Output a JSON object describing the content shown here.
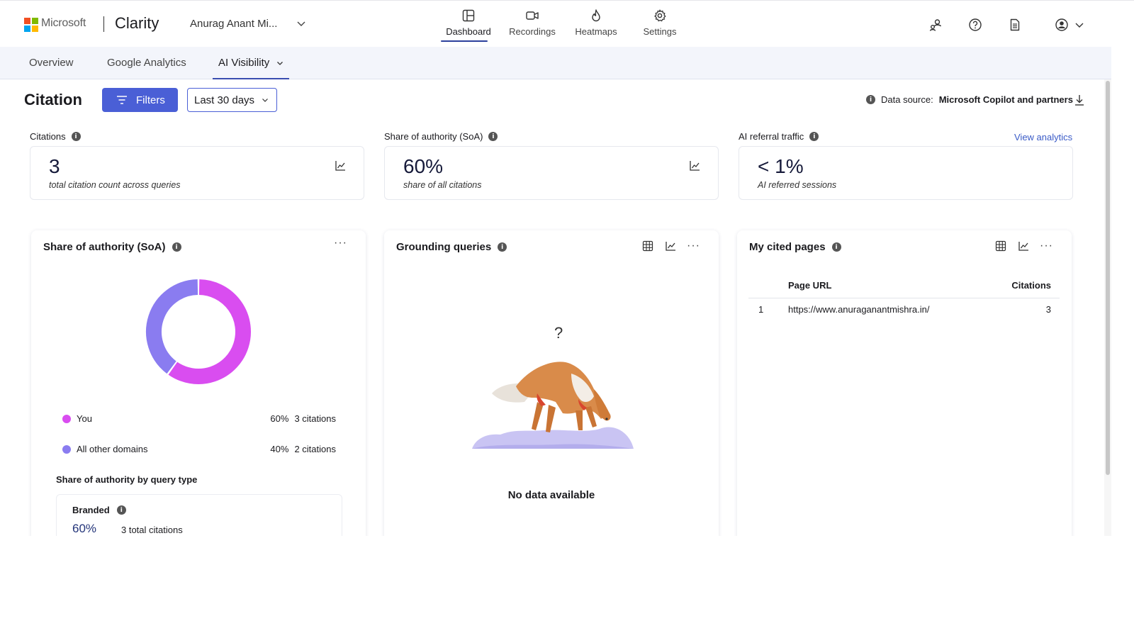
{
  "header": {
    "ms_word": "Microsoft",
    "brand": "Clarity",
    "project": "Anurag Anant Mi...",
    "nav": [
      {
        "label": "Dashboard",
        "icon": "dashboard-icon",
        "active": true
      },
      {
        "label": "Recordings",
        "icon": "video-camera-icon",
        "active": false
      },
      {
        "label": "Heatmaps",
        "icon": "flame-icon",
        "active": false
      },
      {
        "label": "Settings",
        "icon": "gear-icon",
        "active": false
      }
    ],
    "right_icons": [
      "people-icon",
      "help-icon",
      "document-icon",
      "account-icon",
      "chevron-down-icon"
    ],
    "logo_colors": [
      "#f25022",
      "#7fba00",
      "#00a4ef",
      "#ffb900"
    ]
  },
  "subnav": {
    "tabs": [
      {
        "label": "Overview",
        "active": false
      },
      {
        "label": "Google Analytics",
        "active": false
      },
      {
        "label": "AI Visibility",
        "active": true
      }
    ]
  },
  "toolbar": {
    "title": "Citation",
    "filters_label": "Filters",
    "range_label": "Last 30 days",
    "datasource_prefix": "Data source:",
    "datasource_value": "Microsoft Copilot and partners"
  },
  "kpis": [
    {
      "label": "Citations",
      "value": "3",
      "sub": "total citation count across queries"
    },
    {
      "label": "Share of authority (SoA)",
      "value": "60%",
      "sub": "share of all citations"
    },
    {
      "label": "AI referral traffic",
      "value": "< 1%",
      "sub": "AI referred sessions",
      "link": "View analytics"
    }
  ],
  "soa_widget": {
    "title": "Share of authority (SoA)",
    "legend": [
      {
        "label": "You",
        "pct": "60%",
        "count": "3 citations",
        "color": "#d94df0"
      },
      {
        "label": "All other domains",
        "pct": "40%",
        "count": "2 citations",
        "color": "#8a7cf0"
      }
    ],
    "donut": [
      {
        "label": "You",
        "fraction": 0.6,
        "color": "#d94df0"
      },
      {
        "label": "All other domains",
        "fraction": 0.4,
        "color": "#8a7cf0"
      }
    ],
    "subhead": "Share of authority by query type",
    "branded": {
      "label": "Branded",
      "pct": "60%",
      "count": "3 total citations"
    }
  },
  "grounding_widget": {
    "title": "Grounding queries",
    "question_mark": "?",
    "empty_text": "No data available"
  },
  "cited_widget": {
    "title": "My cited pages",
    "columns": [
      "Page URL",
      "Citations"
    ],
    "rows": [
      {
        "n": "1",
        "url": "https://www.anuraganantmishra.in/",
        "citations": "3"
      }
    ]
  },
  "colors": {
    "accent": "#4a5fd6",
    "link": "#3a5bc7"
  }
}
